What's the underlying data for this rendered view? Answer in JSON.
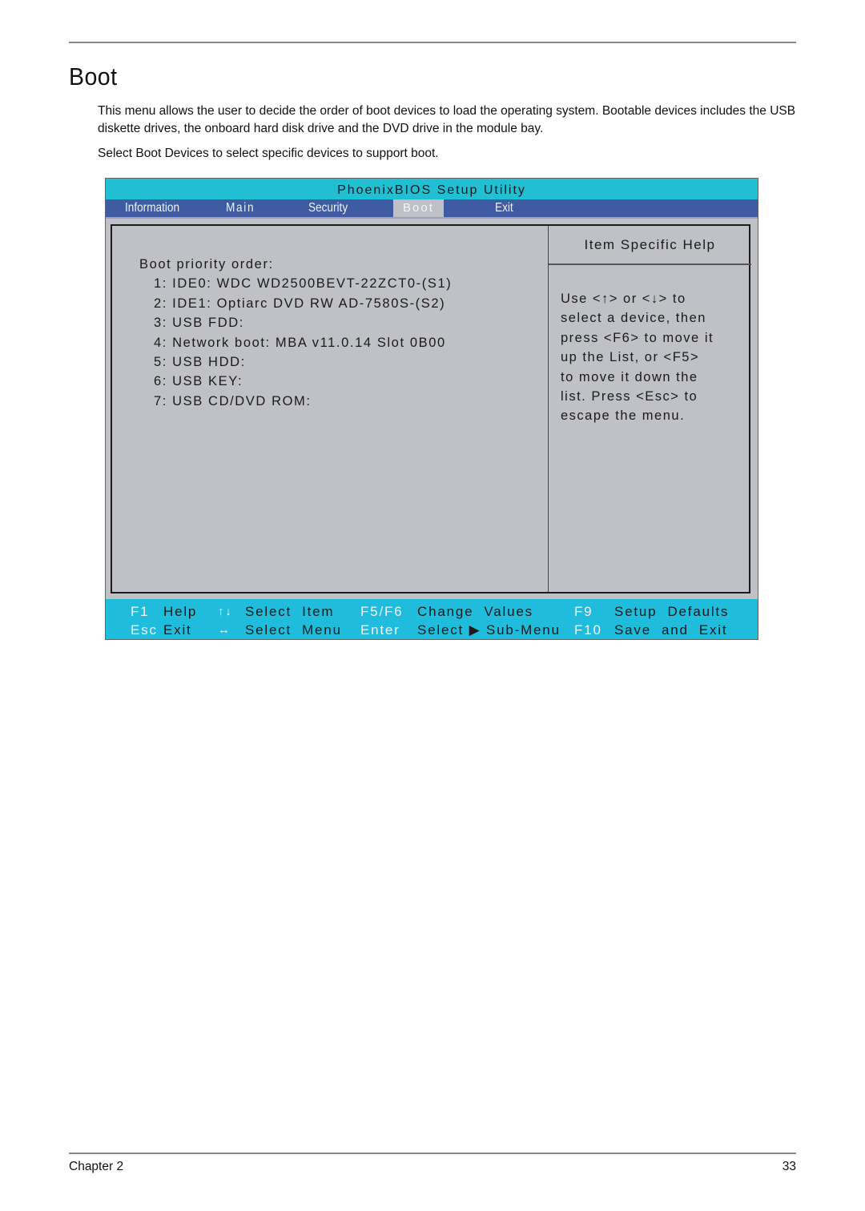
{
  "document": {
    "title": "Boot",
    "paragraphs": [
      "This menu allows the user to decide the order of boot devices to load the operating system. Bootable devices includes the USB diskette drives, the onboard hard disk drive and the DVD drive in the module bay.",
      "Select Boot Devices to select specific devices to support boot."
    ],
    "footer": {
      "chapter": "Chapter 2",
      "page_number": "33"
    }
  },
  "bios": {
    "title": "PhoenixBIOS Setup Utility",
    "menu": [
      {
        "label": "Information",
        "active": false
      },
      {
        "label": "Main",
        "active": false
      },
      {
        "label": "Security",
        "active": false
      },
      {
        "label": "Boot",
        "active": true
      },
      {
        "label": "Exit",
        "active": false
      }
    ],
    "boot_priority_label": "Boot priority order:",
    "boot_devices": [
      "1: IDE0: WDC WD2500BEVT-22ZCT0-(S1)",
      "2: IDE1: Optiarc DVD RW AD-7580S-(S2)",
      "3: USB FDD:",
      "4: Network boot: MBA v11.0.14 Slot 0B00",
      "5: USB HDD:",
      "6: USB KEY:",
      "7: USB CD/DVD ROM:"
    ],
    "help": {
      "header": "Item Specific Help",
      "lines": [
        "Use <↑> or <↓> to",
        "select a device, then",
        "press <F6> to move it",
        "up the List, or <F5>",
        "to move it down the",
        "list. Press <Esc> to",
        "escape the menu."
      ]
    },
    "footer_keys": {
      "row1": [
        {
          "key": "F1",
          "action": "Help"
        },
        {
          "key": "↑↓",
          "action": "Select  Item",
          "icon": "up-down-arrows-icon"
        },
        {
          "key": "F5/F6",
          "action": "Change  Values"
        },
        {
          "key": "F9",
          "action": "Setup  Defaults"
        }
      ],
      "row2": [
        {
          "key": "Esc",
          "action": "Exit"
        },
        {
          "key": "↔",
          "action": "Select  Menu",
          "icon": "left-right-arrows-icon"
        },
        {
          "key": "Enter",
          "action": "Select ▶ Sub-Menu"
        },
        {
          "key": "F10",
          "action": "Save  and  Exit"
        }
      ]
    },
    "colors": {
      "title_bar": "#22bed2",
      "menu_bar": "#3f5ba2",
      "body": "#c0c1c6",
      "footer": "#1fbcdc",
      "key_text": "#f3f3f3"
    }
  }
}
